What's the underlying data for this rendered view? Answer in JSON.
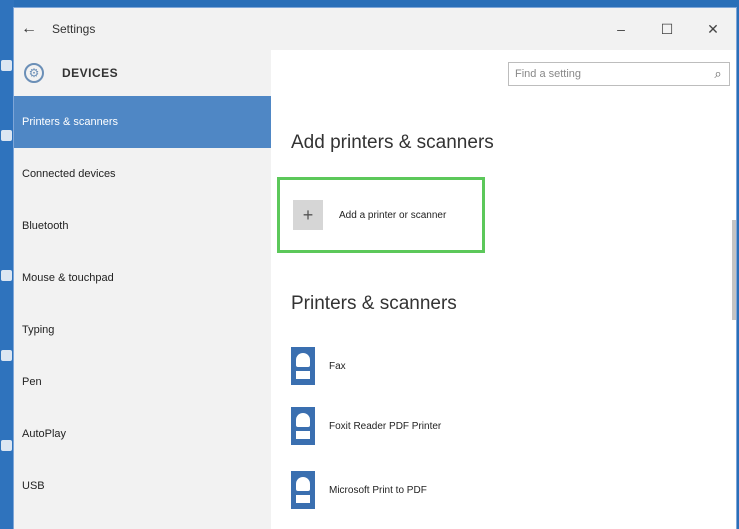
{
  "window": {
    "title": "Settings",
    "back_glyph": "←",
    "controls": {
      "minimize": "–",
      "maximize": "☐",
      "close": "✕"
    }
  },
  "sidebar": {
    "header": "DEVICES",
    "icon": "gear-icon",
    "items": [
      {
        "label": "Printers & scanners",
        "active": true
      },
      {
        "label": "Connected devices"
      },
      {
        "label": "Bluetooth"
      },
      {
        "label": "Mouse & touchpad"
      },
      {
        "label": "Typing"
      },
      {
        "label": "Pen"
      },
      {
        "label": "AutoPlay"
      },
      {
        "label": "USB"
      }
    ]
  },
  "search": {
    "placeholder": "Find a setting"
  },
  "main": {
    "add_heading": "Add printers & scanners",
    "add_button_label": "Add a printer or scanner",
    "list_heading": "Printers & scanners",
    "printers": [
      {
        "name": "Fax"
      },
      {
        "name": "Foxit Reader PDF Printer"
      },
      {
        "name": "Microsoft Print to PDF"
      }
    ]
  },
  "colors": {
    "accent": "#4f87c5",
    "highlight_border": "#5cc85a",
    "sidebar_bg": "#f2f2f2"
  }
}
